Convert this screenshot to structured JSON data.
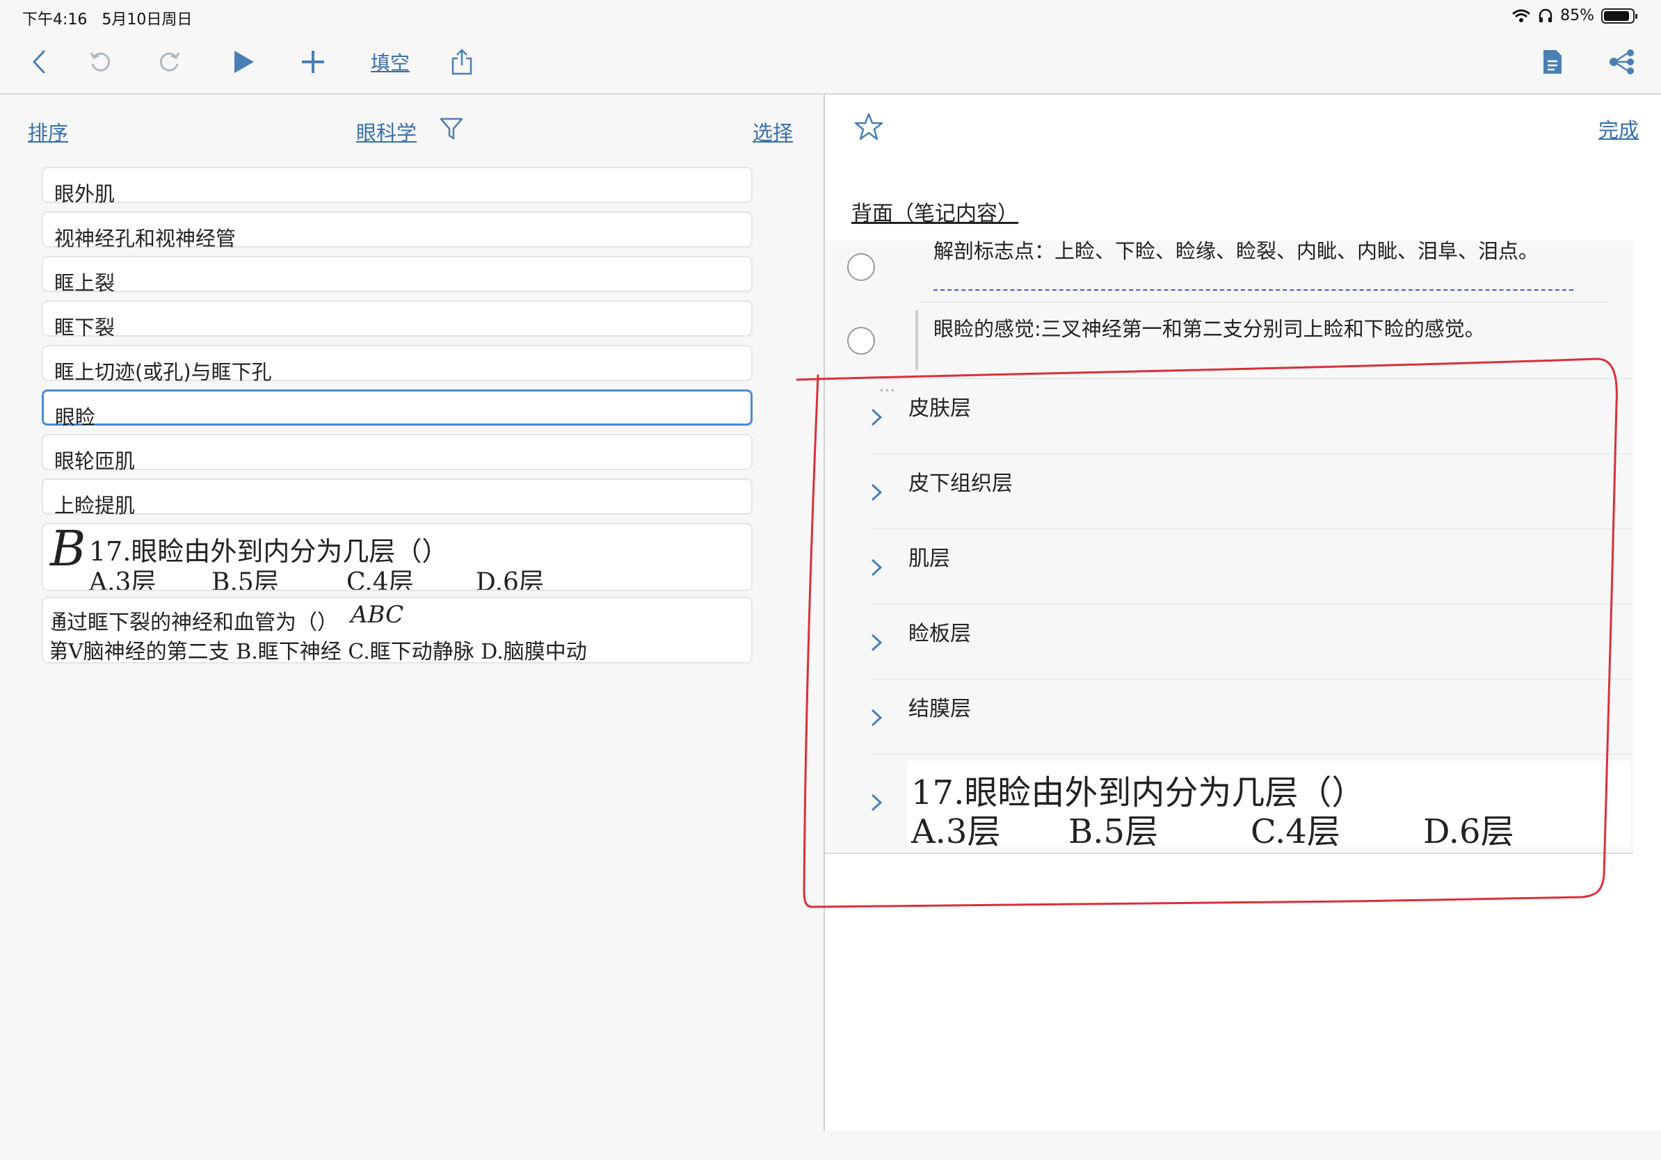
{
  "status_bar": {
    "time": "下午4:16",
    "date": "5月10日周日",
    "battery": "85%",
    "battery_level": 0.85
  },
  "toolbar": {
    "fill_blank_label": "填空"
  },
  "left_pane": {
    "sort_label": "排序",
    "category_label": "眼科学",
    "select_label": "选择",
    "items": [
      {
        "label": "眼外肌"
      },
      {
        "label": "视神经孔和视神经管"
      },
      {
        "label": "眶上裂"
      },
      {
        "label": "眶下裂"
      },
      {
        "label": "眶上切迹(或孔)与眶下孔"
      },
      {
        "label": "眼睑",
        "selected": true
      },
      {
        "label": "眼轮匝肌"
      },
      {
        "label": "上睑提肌"
      }
    ],
    "image_card_1": {
      "handwritten_answer": "B",
      "question": "17.眼睑由外到内分为几层（）",
      "options": [
        "A.3层",
        "B.5层",
        "C.4层",
        "D.6层"
      ]
    },
    "image_card_2": {
      "question": "通过眶下裂的神经和血管为（）",
      "handwritten_answer": "ABC",
      "options_line": "第V脑神经的第二支 B.眶下神经 C.眶下动静脉 D.脑膜中动"
    }
  },
  "right_pane": {
    "done_label": "完成",
    "back_label": "背面（笔记内容）",
    "notes": [
      "解剖标志点：上睑、下睑、睑缘、睑裂、内眦、内眦、泪阜、泪点。",
      "眼睑的感觉:三叉神经第一和第二支分别司上睑和下睑的感觉。"
    ],
    "layers": [
      {
        "label": "皮肤层"
      },
      {
        "label": "皮下组织层"
      },
      {
        "label": "肌层"
      },
      {
        "label": "睑板层"
      },
      {
        "label": "结膜层"
      }
    ],
    "image_row": {
      "question": "17.眼睑由外到内分为几层（）",
      "options": [
        "A.3层",
        "B.5层",
        "C.4层",
        "D.6层"
      ]
    }
  },
  "colors": {
    "accent": "#3a6fa8",
    "selection": "#4a8ad8",
    "annotation": "#d9303a"
  }
}
